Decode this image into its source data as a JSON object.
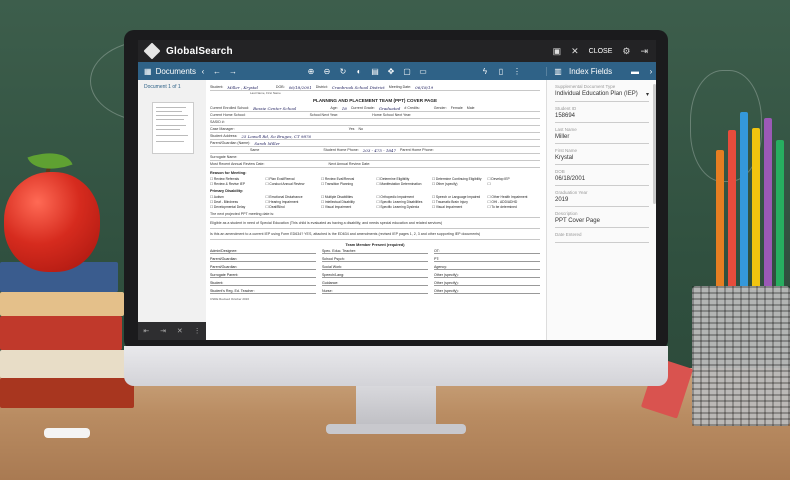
{
  "app": {
    "name": "GlobalSearch",
    "close_label": "CLOSE"
  },
  "toolbar": {
    "documents_label": "Documents",
    "index_fields_label": "Index Fields"
  },
  "left_panel": {
    "document_counter": "Document 1 of 1"
  },
  "form": {
    "title": "PLANNING AND PLACEMENT TEAM (PPT) COVER PAGE",
    "student_label": "Student:",
    "student_value": "Miller , Krystal",
    "student_sub": "Last Name, First Name",
    "dob_label": "DOB:",
    "dob_value": "06/18/2001",
    "district_label": "District:",
    "district_value": "Cranbrook School District",
    "meeting_label": "Meeting Date:",
    "meeting_value": "06/18/19",
    "school_label": "Current Enrolled School:",
    "school_value": "Bessie Center School",
    "age_label": "Age:",
    "age_value": "18",
    "grade_label": "Current Grade:",
    "grade_value": "Graduated",
    "credits_label": "# Credits:",
    "gender_label": "Gender:",
    "female": "Female",
    "male": "Male",
    "home_school_label": "Current Home School:",
    "next_year_label": "School Next Year:",
    "home_next_label": "Home School Next Year:",
    "sasid_label": "SASID #:",
    "case_manager_label": "Case Manager:",
    "address_label": "Student Address:",
    "address_value": "25 Lowell Rd, So Bruges, CT 9876",
    "parent_label": "Parent/Guardian (Name):",
    "parent_value": "Sarah Miller",
    "surrogate_label": "Surrogate Name:",
    "same_label": "Same",
    "home_phone_label": "Student Home Phone:",
    "home_phone_value": "203 - 475 - 1847",
    "parent_phone_label": "Parent Home Phone:",
    "most_recent_annual": "Most Recent Annual Review Date:",
    "next_annual": "Next Annual Review Date:",
    "reason_label": "Reason for Meeting:",
    "primary_label": "Primary Disability:",
    "reasons": [
      "Review Referrals",
      "Plan Eval/Reeval",
      "Review Eval/Reeval",
      "Determine Eligibility",
      "Determine Continuing Eligibility",
      "Develop IEP",
      "Review & Revise IEP",
      "Conduct Annual Review",
      "Transition Planning",
      "Manifestation Determination",
      "Other (specify)",
      ""
    ],
    "disabilities": [
      "Autism",
      "Emotional Disturbance",
      "Multiple Disabilities",
      "Orthopedic Impairment",
      "Speech or Language Impaired",
      "Other Health Impairment",
      "Deaf - Blindness",
      "Hearing Impairment",
      "Intellectual Disability",
      "Specific Learning Disabilities",
      "Traumatic Brain Injury",
      "OHI - ADD/ADHD",
      "Developmental Delay",
      "Deaf/Blind",
      "Visual Impairment",
      "Specific Learning Dyslexia",
      "Visual Impairment",
      "To be determined"
    ],
    "projected_label": "The next projected PPT meeting date is:",
    "eligible_text": "Eligible as a student in need of Special Education (This child is evaluated as having a disability, and needs special education and related services)",
    "amendment_text": "Is this an amendment to a current IEP using Form ED634? YES, attached is the ED634 and amendments (revised IEP pages 1, 2, 3 and other supporting IEP documents)",
    "yes": "Yes",
    "no": "No",
    "team_title": "Team Member Present (required)",
    "team_left": [
      "Admin/Designee:",
      "Parent/Guardian:",
      "Parent/Guardian:",
      "Surrogate Parent:",
      "Student:",
      "Student's Reg. Ed. Teacher:"
    ],
    "team_mid": [
      "Spec. Educ. Teacher:",
      "School Psych:",
      "Social Work:",
      "Speech/Lang:",
      "Guidance:",
      "Nurse:"
    ],
    "team_right": [
      "OT:",
      "PT:",
      "Agency:",
      "Other (specify):",
      "Other (specify):",
      "Other (specify):"
    ],
    "footer": "CSDE Revised October 2016"
  },
  "index_fields": [
    {
      "label": "Supplemental Document Type",
      "value": "Individual Education Plan (IEP)",
      "dropdown": true
    },
    {
      "label": "Student ID",
      "value": "158694"
    },
    {
      "label": "Last Name",
      "value": "Miller"
    },
    {
      "label": "First Name",
      "value": "Krystal"
    },
    {
      "label": "DOB",
      "value": "06/18/2001"
    },
    {
      "label": "Graduation Year",
      "value": "2019"
    },
    {
      "label": "Description",
      "value": "PPT Cover Page"
    },
    {
      "label": "Date Entered",
      "value": ""
    }
  ],
  "colors": {
    "toolbar": "#2f6287",
    "topbar": "#232325"
  }
}
